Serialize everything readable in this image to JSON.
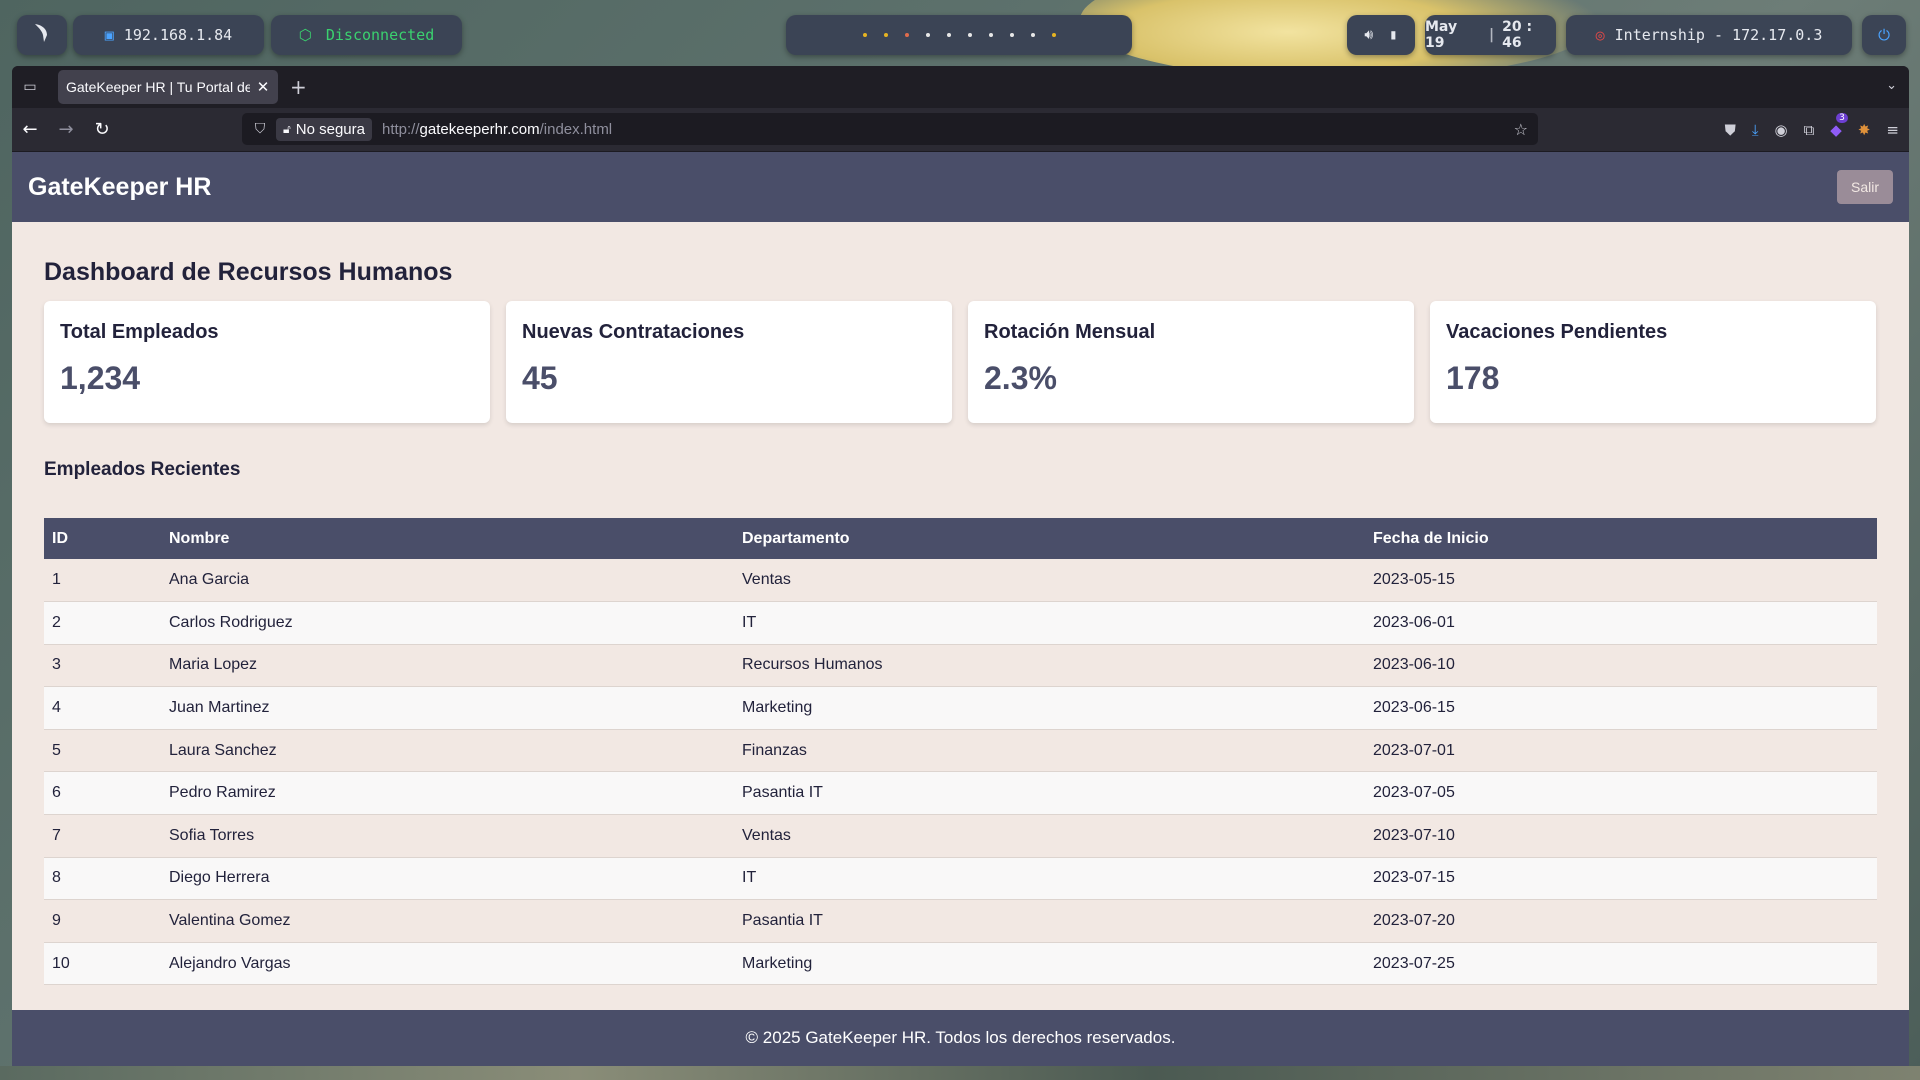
{
  "panel": {
    "ip": "192.168.1.84",
    "vpn_status": "Disconnected",
    "clock_date": "May 19",
    "clock_time": "20 : 46",
    "target": "Internship - 172.17.0.3"
  },
  "browser": {
    "tab_title": "GateKeeper HR | Tu Portal de",
    "security_label": "No segura",
    "url_proto": "http://",
    "url_host": "gatekeeperhr.com",
    "url_path": "/index.html",
    "extension_badge": "3"
  },
  "app": {
    "brand": "GateKeeper HR",
    "logout_label": "Salir",
    "dashboard_title": "Dashboard de Recursos Humanos",
    "cards": [
      {
        "title": "Total Empleados",
        "value": "1,234"
      },
      {
        "title": "Nuevas Contrataciones",
        "value": "45"
      },
      {
        "title": "Rotación Mensual",
        "value": "2.3%"
      },
      {
        "title": "Vacaciones Pendientes",
        "value": "178"
      }
    ],
    "recent_title": "Empleados Recientes",
    "table": {
      "headers": [
        "ID",
        "Nombre",
        "Departamento",
        "Fecha de Inicio"
      ],
      "rows": [
        [
          "1",
          "Ana Garcia",
          "Ventas",
          "2023-05-15"
        ],
        [
          "2",
          "Carlos Rodriguez",
          "IT",
          "2023-06-01"
        ],
        [
          "3",
          "Maria Lopez",
          "Recursos Humanos",
          "2023-06-10"
        ],
        [
          "4",
          "Juan Martinez",
          "Marketing",
          "2023-06-15"
        ],
        [
          "5",
          "Laura Sanchez",
          "Finanzas",
          "2023-07-01"
        ],
        [
          "6",
          "Pedro Ramirez",
          "Pasantia IT",
          "2023-07-05"
        ],
        [
          "7",
          "Sofia Torres",
          "Ventas",
          "2023-07-10"
        ],
        [
          "8",
          "Diego Herrera",
          "IT",
          "2023-07-15"
        ],
        [
          "9",
          "Valentina Gomez",
          "Pasantia IT",
          "2023-07-20"
        ],
        [
          "10",
          "Alejandro Vargas",
          "Marketing",
          "2023-07-25"
        ]
      ]
    },
    "footer": "© 2025 GateKeeper HR. Todos los derechos reservados."
  },
  "colors": {
    "header_bg": "#4a4e69",
    "page_bg": "#f2e8e3",
    "logout_bg": "#9a8c98",
    "vpn_green": "#3bd16f"
  }
}
